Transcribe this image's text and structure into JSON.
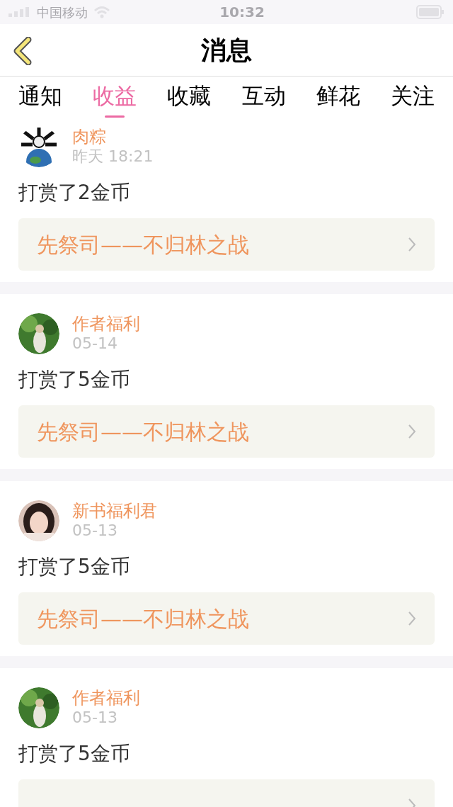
{
  "status_bar": {
    "carrier": "中国移动",
    "time": "10:32"
  },
  "nav": {
    "title": "消息"
  },
  "tabs": [
    {
      "label": "通知",
      "selected": false
    },
    {
      "label": "收益",
      "selected": true
    },
    {
      "label": "收藏",
      "selected": false
    },
    {
      "label": "互动",
      "selected": false
    },
    {
      "label": "鲜花",
      "selected": false
    },
    {
      "label": "关注",
      "selected": false
    }
  ],
  "messages": [
    {
      "name": "肉粽",
      "time": "昨天 18:21",
      "text": "打赏了2金币",
      "book": "先祭司——不归林之战"
    },
    {
      "name": "作者福利",
      "time": "05-14",
      "text": "打赏了5金币",
      "book": "先祭司——不归林之战"
    },
    {
      "name": "新书福利君",
      "time": "05-13",
      "text": "打赏了5金币",
      "book": "先祭司——不归林之战"
    },
    {
      "name": "作者福利",
      "time": "05-13",
      "text": "打赏了5金币"
    }
  ]
}
